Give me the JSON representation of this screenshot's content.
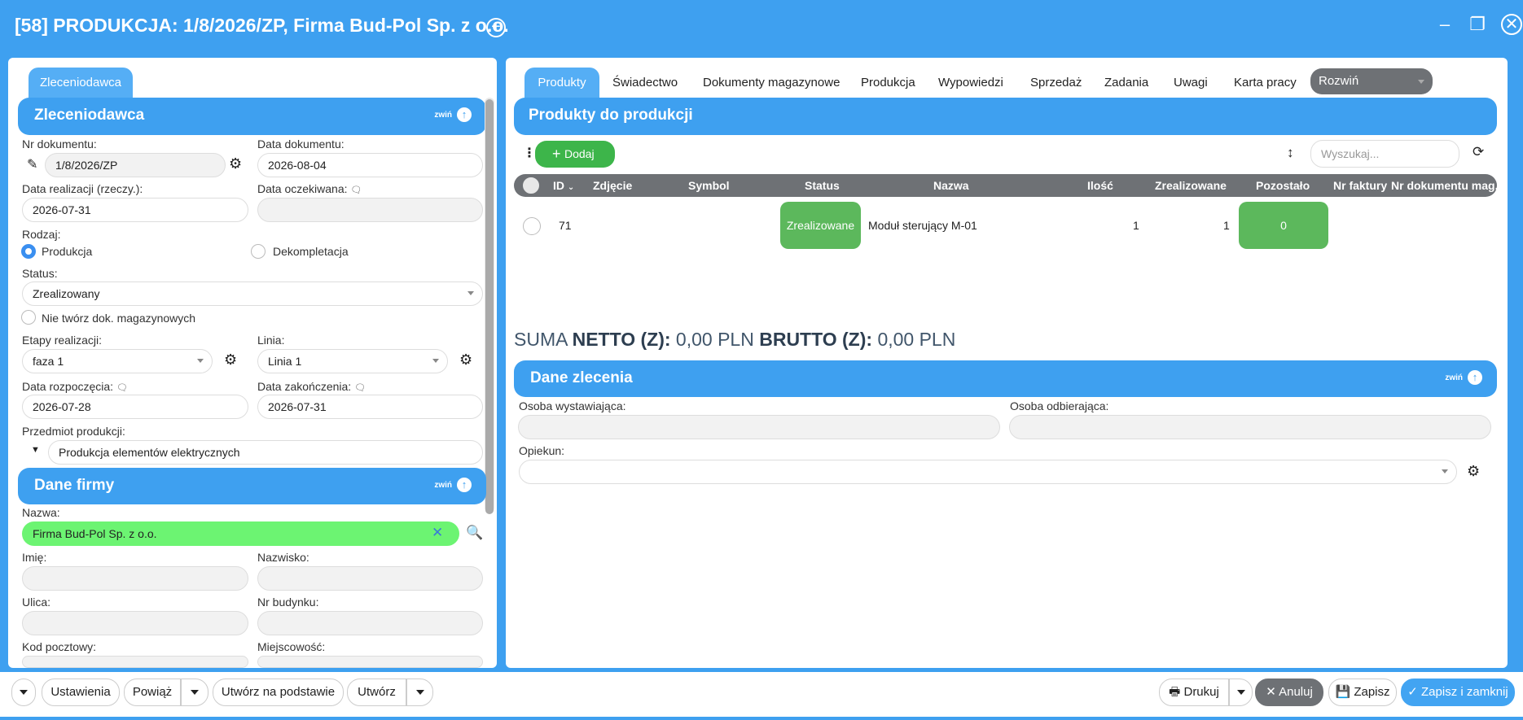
{
  "window": {
    "title": "[58] PRODUKCJA: 1/8/2026/ZP, Firma Bud-Pol Sp. z o.o.",
    "plus_icon": "+",
    "minimize_icon": "–",
    "restore_icon": "❐",
    "close_icon": "✕"
  },
  "left": {
    "tab_label": "Zleceniodawca",
    "section_title": "Zleceniodawca",
    "collapse_label": "zwiń",
    "nr_dokumentu_label": "Nr dokumentu:",
    "nr_dokumentu_value": "1/8/2026/ZP",
    "data_dokumentu_label": "Data dokumentu:",
    "data_dokumentu_value": "2026-08-04",
    "data_realizacji_label": "Data realizacji (rzeczy.):",
    "data_realizacji_value": "2026-07-31",
    "data_oczekiwana_label": "Data oczekiwana:",
    "data_oczekiwana_value": "",
    "rodzaj_label": "Rodzaj:",
    "rodzaj_options": [
      "Produkcja",
      "Dekompletacja"
    ],
    "status_label": "Status:",
    "status_value": "Zrealizowany",
    "nie_tworz_label": "Nie twórz dok. magazynowych",
    "etapy_label": "Etapy realizacji:",
    "etapy_value": "faza 1",
    "linia_label": "Linia:",
    "linia_value": "Linia 1",
    "data_rozpoczecia_label": "Data rozpoczęcia:",
    "data_rozpoczecia_value": "2026-07-28",
    "data_zakonczenia_label": "Data zakończenia:",
    "data_zakonczenia_value": "2026-07-31",
    "przedmiot_label": "Przedmiot produkcji:",
    "przedmiot_value": "Produkcja elementów elektrycznych",
    "firma_section_title": "Dane firmy",
    "nazwa_label": "Nazwa:",
    "nazwa_value": "Firma Bud-Pol Sp. z o.o.",
    "imie_label": "Imię:",
    "nazwisko_label": "Nazwisko:",
    "ulica_label": "Ulica:",
    "nr_budynku_label": "Nr budynku:",
    "kod_label": "Kod pocztowy:",
    "miejscowosc_label": "Miejscowość:"
  },
  "right": {
    "tabs": [
      "Produkty",
      "Świadectwo",
      "Dokumenty magazynowe",
      "Produkcja",
      "Wypowiedzi",
      "Sprzedaż",
      "Zadania",
      "Uwagi",
      "Karta pracy"
    ],
    "rozwin_label": "Rozwiń",
    "products_section_title": "Produkty do produkcji",
    "add_label": "Dodaj",
    "search_placeholder": "Wyszukaj...",
    "table_headers": [
      "ID",
      "Zdjęcie",
      "Symbol",
      "Status",
      "Nazwa",
      "Ilość",
      "Zrealizowane",
      "Pozostało",
      "Nr faktury",
      "Nr dokumentu mag."
    ],
    "rows": [
      {
        "id": "71",
        "zdjecie": "",
        "symbol": "",
        "status": "Zrealizowane",
        "nazwa": "Moduł sterujący M-01",
        "ilosc": "1",
        "zrealizowane": "1",
        "pozostalo": "0",
        "nr_faktury": "",
        "nr_dok_mag": ""
      }
    ],
    "sum_prefix": "SUMA",
    "sum_netto_label": "NETTO (Z):",
    "sum_netto_value": "0,00 PLN",
    "sum_brutto_label": "BRUTTO (Z):",
    "sum_brutto_value": "0,00 PLN",
    "order_section_title": "Dane zlecenia",
    "collapse_label": "zwiń",
    "osoba_wystawiajaca_label": "Osoba wystawiająca:",
    "osoba_odbierajaca_label": "Osoba odbierająca:",
    "opiekun_label": "Opiekun:"
  },
  "footer": {
    "ustawienia": "Ustawienia",
    "powiaz": "Powiąż",
    "utworz_na_podstawie": "Utwórz na podstawie",
    "utworz": "Utwórz",
    "drukuj": "Drukuj",
    "anuluj": "Anuluj",
    "zapisz": "Zapisz",
    "zapisz_i_zamknij": "Zapisz i zamknij"
  },
  "colors": {
    "accent": "#3ea0f0",
    "green": "#3db54a",
    "status_green": "#5cb85c",
    "dark_gray": "#6e7175",
    "company_field_green": "#6cf472"
  }
}
